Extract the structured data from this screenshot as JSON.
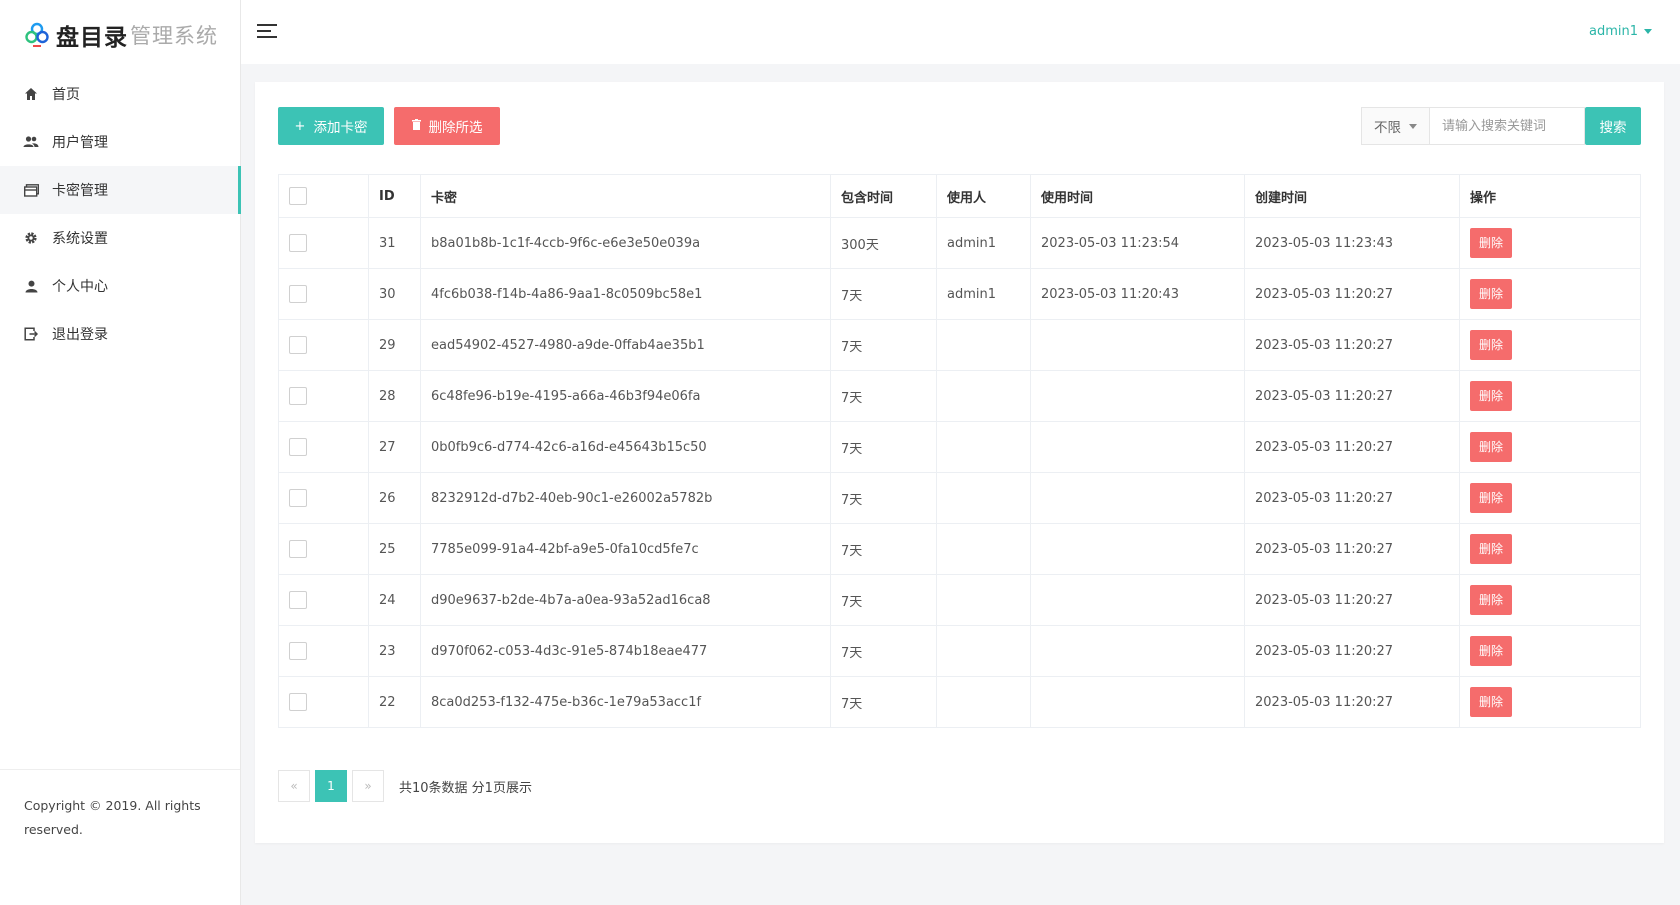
{
  "brand": {
    "name_main": "盘目录",
    "name_sub": "管理系统"
  },
  "sidebar": {
    "items": [
      {
        "label": "首页",
        "icon": "home-icon",
        "active": false
      },
      {
        "label": "用户管理",
        "icon": "users-icon",
        "active": false
      },
      {
        "label": "卡密管理",
        "icon": "card-icon",
        "active": true
      },
      {
        "label": "系统设置",
        "icon": "gear-icon",
        "active": false
      },
      {
        "label": "个人中心",
        "icon": "user-icon",
        "active": false
      },
      {
        "label": "退出登录",
        "icon": "logout-icon",
        "active": false
      }
    ],
    "copyright": "Copyright © 2019. All rights reserved."
  },
  "header": {
    "user": "admin1"
  },
  "toolbar": {
    "add_label": "添加卡密",
    "delete_selected_label": "删除所选",
    "filter_value": "不限",
    "search_placeholder": "请输入搜索关键词",
    "search_label": "搜索"
  },
  "table": {
    "columns": [
      "ID",
      "卡密",
      "包含时间",
      "使用人",
      "使用时间",
      "创建时间",
      "操作"
    ],
    "rows": [
      {
        "id": "31",
        "code": "b8a01b8b-1c1f-4ccb-9f6c-e6e3e50e039a",
        "duration": "300天",
        "user": "admin1",
        "used_at": "2023-05-03 11:23:54",
        "created_at": "2023-05-03 11:23:43",
        "action": "删除"
      },
      {
        "id": "30",
        "code": "4fc6b038-f14b-4a86-9aa1-8c0509bc58e1",
        "duration": "7天",
        "user": "admin1",
        "used_at": "2023-05-03 11:20:43",
        "created_at": "2023-05-03 11:20:27",
        "action": "删除"
      },
      {
        "id": "29",
        "code": "ead54902-4527-4980-a9de-0ffab4ae35b1",
        "duration": "7天",
        "user": "",
        "used_at": "",
        "created_at": "2023-05-03 11:20:27",
        "action": "删除"
      },
      {
        "id": "28",
        "code": "6c48fe96-b19e-4195-a66a-46b3f94e06fa",
        "duration": "7天",
        "user": "",
        "used_at": "",
        "created_at": "2023-05-03 11:20:27",
        "action": "删除"
      },
      {
        "id": "27",
        "code": "0b0fb9c6-d774-42c6-a16d-e45643b15c50",
        "duration": "7天",
        "user": "",
        "used_at": "",
        "created_at": "2023-05-03 11:20:27",
        "action": "删除"
      },
      {
        "id": "26",
        "code": "8232912d-d7b2-40eb-90c1-e26002a5782b",
        "duration": "7天",
        "user": "",
        "used_at": "",
        "created_at": "2023-05-03 11:20:27",
        "action": "删除"
      },
      {
        "id": "25",
        "code": "7785e099-91a4-42bf-a9e5-0fa10cd5fe7c",
        "duration": "7天",
        "user": "",
        "used_at": "",
        "created_at": "2023-05-03 11:20:27",
        "action": "删除"
      },
      {
        "id": "24",
        "code": "d90e9637-b2de-4b7a-a0ea-93a52ad16ca8",
        "duration": "7天",
        "user": "",
        "used_at": "",
        "created_at": "2023-05-03 11:20:27",
        "action": "删除"
      },
      {
        "id": "23",
        "code": "d970f062-c053-4d3c-91e5-874b18eae477",
        "duration": "7天",
        "user": "",
        "used_at": "",
        "created_at": "2023-05-03 11:20:27",
        "action": "删除"
      },
      {
        "id": "22",
        "code": "8ca0d253-f132-475e-b36c-1e79a53acc1f",
        "duration": "7天",
        "user": "",
        "used_at": "",
        "created_at": "2023-05-03 11:20:27",
        "action": "删除"
      }
    ]
  },
  "pagination": {
    "prev": "«",
    "current": "1",
    "next": "»",
    "summary": "共10条数据 分1页展示"
  },
  "colors": {
    "accent": "#3cc3b5",
    "danger": "#f56c6c"
  }
}
